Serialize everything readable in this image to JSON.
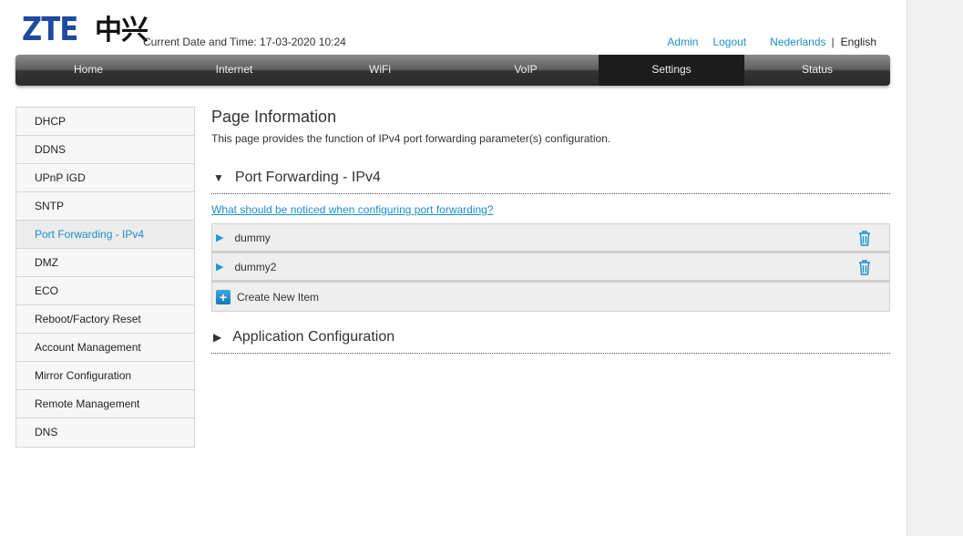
{
  "header": {
    "logo_text": "ZTE中兴",
    "datetime": "Current Date and Time: 17-03-2020 10:24",
    "links": {
      "admin": "Admin",
      "logout": "Logout",
      "dutch": "Nederlands",
      "sep": "|",
      "english": "English"
    }
  },
  "nav": [
    "Home",
    "Internet",
    "WiFi",
    "VoIP",
    "Settings",
    "Status"
  ],
  "sidebar": [
    "DHCP",
    "DDNS",
    "UPnP IGD",
    "SNTP",
    "Port Forwarding - IPv4",
    "DMZ",
    "ECO",
    "Reboot/Factory Reset",
    "Account Management",
    "Mirror Configuration",
    "Remote Management",
    "DNS"
  ],
  "main": {
    "title": "Page Information",
    "description": "This page provides the function of IPv4 port forwarding parameter(s) configuration.",
    "section1": "Port Forwarding - IPv4",
    "help_link": "What should be noticed when configuring port forwarding?",
    "items": [
      "dummy",
      "dummy2"
    ],
    "create": "Create New Item",
    "section2": "Application Configuration"
  }
}
